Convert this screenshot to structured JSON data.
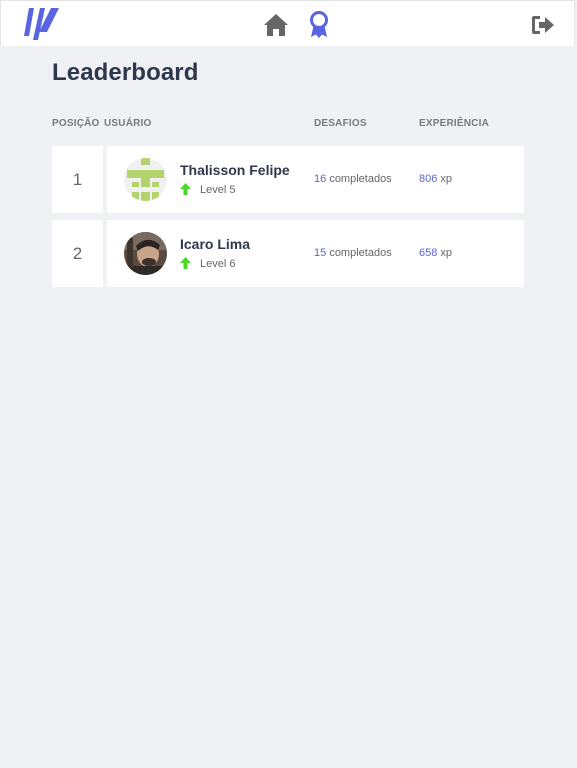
{
  "app": {
    "logo_name": "moveit-logo",
    "nav": [
      {
        "name": "home",
        "icon": "home-icon"
      },
      {
        "name": "leaderboard",
        "icon": "award-icon",
        "active": true
      },
      {
        "name": "logout",
        "icon": "logout-icon"
      }
    ]
  },
  "page": {
    "title": "Leaderboard"
  },
  "table": {
    "headers": {
      "position": "POSIÇÃO",
      "user": "USUÁRIO",
      "challenges": "DESAFIOS",
      "experience": "EXPERIÊNCIA"
    },
    "rows": [
      {
        "position": "1",
        "name": "Thalisson Felipe",
        "level": "Level 5",
        "challenges_count": "16",
        "challenges_suffix": "completados",
        "xp_value": "806",
        "xp_suffix": "xp",
        "avatar": "identicon-avatar"
      },
      {
        "position": "2",
        "name": "Icaro Lima",
        "level": "Level 6",
        "challenges_count": "15",
        "challenges_suffix": "completados",
        "xp_value": "658",
        "xp_suffix": "xp",
        "avatar": "photo-avatar"
      }
    ]
  },
  "colors": {
    "accent": "#5965E0",
    "background": "#F0F1F4",
    "level_arrow": "#4CD62B",
    "title": "#2E384D",
    "text_muted": "#666666",
    "identicon": "#B3D36D"
  }
}
